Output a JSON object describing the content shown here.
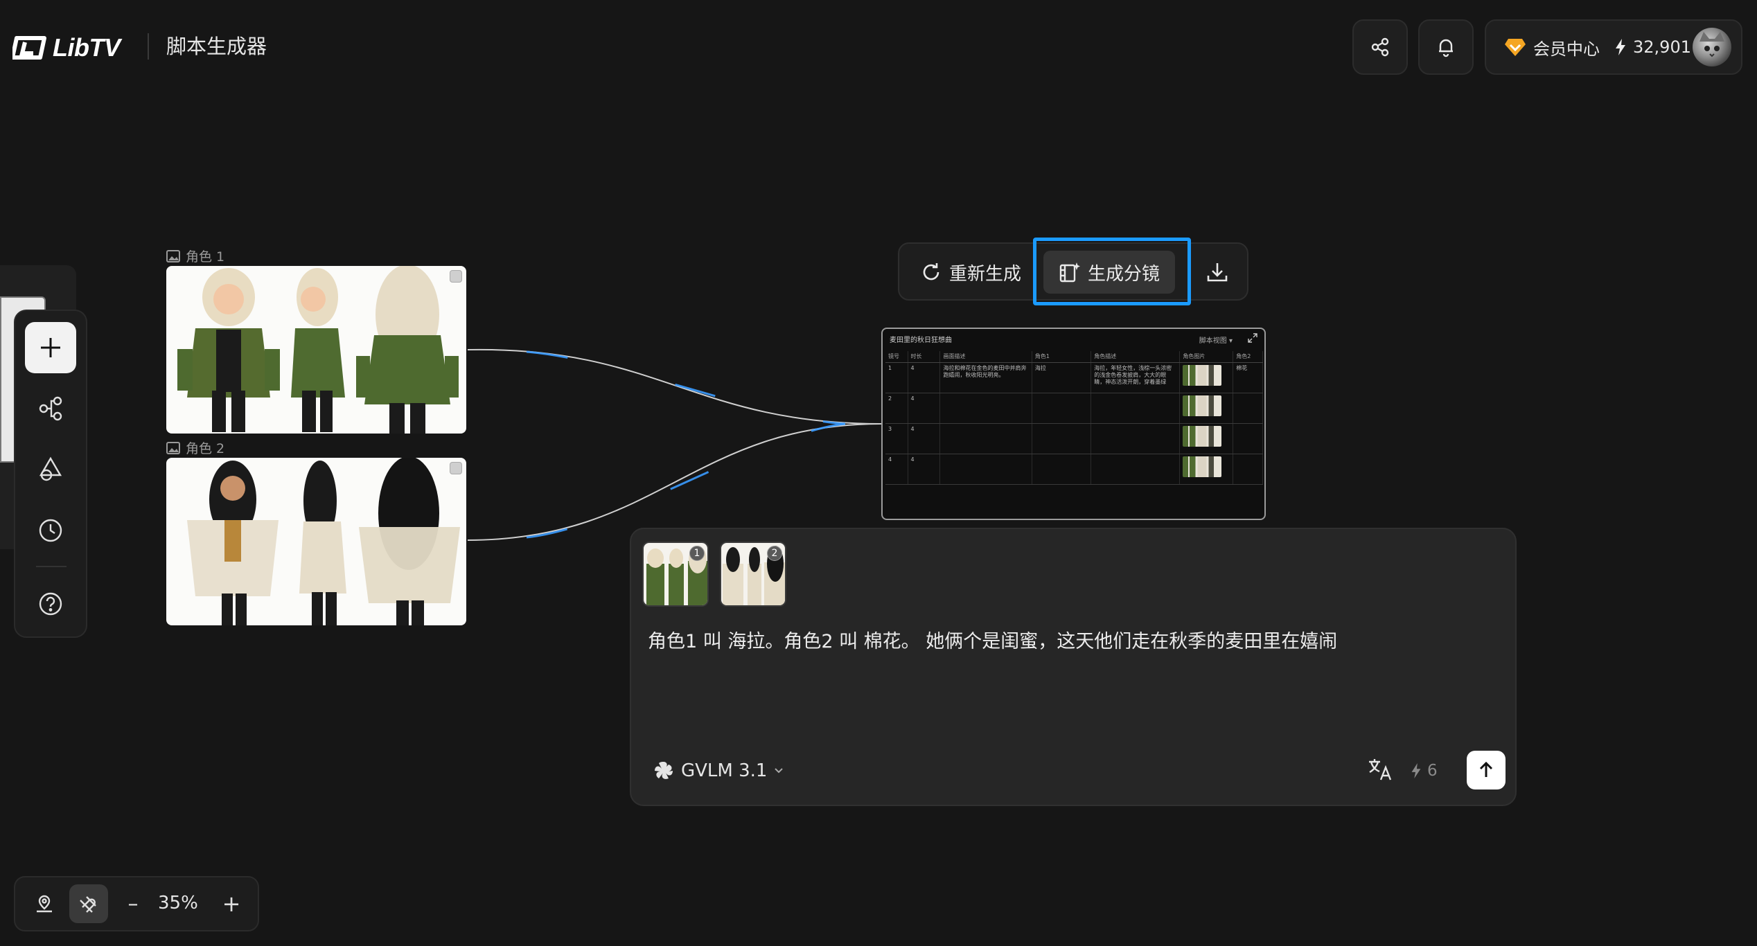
{
  "header": {
    "logo_text": "LibTV",
    "app_title": "脚本生成器",
    "member_center": "会员中心",
    "credits": "32,901",
    "icons": [
      "share-icon",
      "bell-icon",
      "vip-diamond-icon",
      "lightning-icon"
    ]
  },
  "sidebar": {
    "icons": [
      "plus-icon",
      "workflow-icon",
      "shapes-icon",
      "history-clock-icon",
      "help-icon"
    ]
  },
  "nodes": {
    "char1_label": "角色 1",
    "char2_label": "角色 2"
  },
  "floating_toolbar": {
    "regenerate": "重新生成",
    "generate_storyboard": "生成分镜",
    "icons": [
      "refresh-icon",
      "storyboard-sparkle-icon",
      "download-icon"
    ]
  },
  "storyboard": {
    "title": "麦田里的秋日狂想曲",
    "view_label": "脚本视图",
    "columns": [
      "镜号",
      "时长",
      "画面描述",
      "角色1",
      "角色描述",
      "角色图片",
      "角色2"
    ],
    "rows": [
      {
        "no": "1",
        "dur": "4",
        "desc": "海拉和棉花在金色的麦田中并肩奔跑嬉闹，秋收阳光明亮。",
        "c1": "海拉",
        "cdesc": "海拉，年轻女性，浅棕一头浓密的浅金色卷发披肩，大大的眼睛，神态活泼开朗，穿着墨绿",
        "c2": "棉花"
      },
      {
        "no": "2",
        "dur": "4",
        "desc": "",
        "c1": "",
        "cdesc": "",
        "c2": ""
      },
      {
        "no": "3",
        "dur": "4",
        "desc": "",
        "c1": "",
        "cdesc": "",
        "c2": ""
      },
      {
        "no": "4",
        "dur": "4",
        "desc": "",
        "c1": "",
        "cdesc": "",
        "c2": ""
      }
    ]
  },
  "prompt": {
    "ref1_badge": "1",
    "ref2_badge": "2",
    "text": "角色1 叫 海拉。角色2 叫 棉花。  她俩个是闺蜜，这天他们走在秋季的麦田里在嬉闹",
    "model": "GVLM 3.1",
    "cost": "6"
  },
  "zoom": {
    "level": "35%",
    "minus": "–",
    "plus": "+"
  }
}
